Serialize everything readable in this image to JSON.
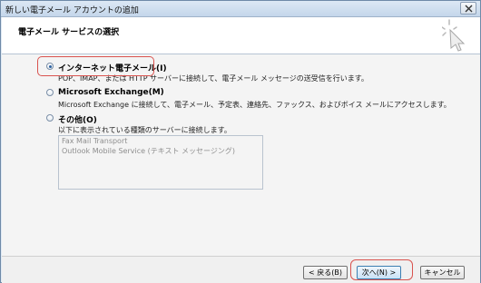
{
  "window": {
    "title": "新しい電子メール アカウントの追加"
  },
  "header": {
    "title": "電子メール サービスの選択"
  },
  "options": [
    {
      "label": "インターネット電子メール(I)",
      "description": "POP、IMAP、または HTTP サーバーに接続して、電子メール メッセージの送受信を行います。",
      "selected": true
    },
    {
      "label": "Microsoft Exchange(M)",
      "description": "Microsoft Exchange に接続して、電子メール、予定表、連絡先、ファックス、およびボイス メールにアクセスします。",
      "selected": false
    },
    {
      "label": "その他(O)",
      "description": "以下に表示されている種類のサーバーに接続します。",
      "selected": false
    }
  ],
  "other_servers": [
    "Fax Mail Transport",
    "Outlook Mobile Service (テキスト メッセージング)"
  ],
  "buttons": {
    "back": "< 戻る(B)",
    "next": "次へ(N) >",
    "cancel": "キャンセル"
  },
  "colors": {
    "highlight": "#d9534f",
    "dialog_bg": "#f4f4f4",
    "header_bg": "#ffffff"
  }
}
